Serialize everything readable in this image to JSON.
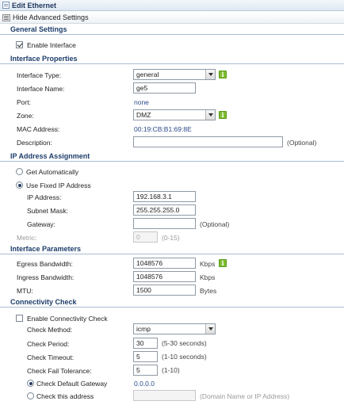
{
  "window": {
    "title": "Edit Ethernet"
  },
  "toolbar": {
    "advanced_label": "Hide Advanced Settings"
  },
  "general": {
    "heading": "General Settings",
    "enable_interface": {
      "label": "Enable Interface",
      "checked": true
    }
  },
  "iface": {
    "heading": "Interface Properties",
    "type": {
      "label": "Interface Type:",
      "value": "general"
    },
    "name": {
      "label": "Interface Name:",
      "value": "ge5"
    },
    "port": {
      "label": "Port:",
      "value": "none"
    },
    "zone": {
      "label": "Zone:",
      "value": "DMZ"
    },
    "mac": {
      "label": "MAC Address:",
      "value": "00:19:CB:B1:69:8E"
    },
    "description": {
      "label": "Description:",
      "value": "",
      "hint": "(Optional)"
    }
  },
  "ip": {
    "heading": "IP Address Assignment",
    "auto_label": "Get Automatically",
    "fixed_label": "Use Fixed IP Address",
    "selected": "fixed",
    "address": {
      "label": "IP Address:",
      "value": "192.168.3.1"
    },
    "mask": {
      "label": "Subnet Mask:",
      "value": "255.255.255.0"
    },
    "gateway": {
      "label": "Gateway:",
      "value": "",
      "hint": "(Optional)"
    },
    "metric": {
      "label": "Metric:",
      "value": "0",
      "hint": "(0-15)"
    }
  },
  "params": {
    "heading": "Interface Parameters",
    "egress": {
      "label": "Egress Bandwidth:",
      "value": "1048576",
      "unit": "Kbps"
    },
    "ingress": {
      "label": "Ingress Bandwidth:",
      "value": "1048576",
      "unit": "Kbps"
    },
    "mtu": {
      "label": "MTU:",
      "value": "1500",
      "unit": "Bytes"
    }
  },
  "conn": {
    "heading": "Connectivity Check",
    "enable": {
      "label": "Enable Connectivity Check",
      "checked": false
    },
    "method": {
      "label": "Check Method:",
      "value": "icmp"
    },
    "period": {
      "label": "Check Period:",
      "value": "30",
      "hint": "(5-30 seconds)"
    },
    "timeout": {
      "label": "Check Timeout:",
      "value": "5",
      "hint": "(1-10 seconds)"
    },
    "fail": {
      "label": "Check Fail Tolerance:",
      "value": "5",
      "hint": "(1-10)"
    },
    "default_gw": {
      "label": "Check Default Gateway",
      "value": "0.0.0.0"
    },
    "this_addr": {
      "label": "Check this address",
      "value": "",
      "hint": "(Domain Name or IP Address)"
    },
    "selected": "default_gw"
  },
  "icons": {
    "info": "i",
    "info_name": "info-icon",
    "title_name": "window-icon",
    "advanced_name": "advanced-settings-icon"
  },
  "colors": {
    "heading": "#1d3d6b",
    "info": "#7dbb2f",
    "link_value": "#2b4b8a"
  }
}
